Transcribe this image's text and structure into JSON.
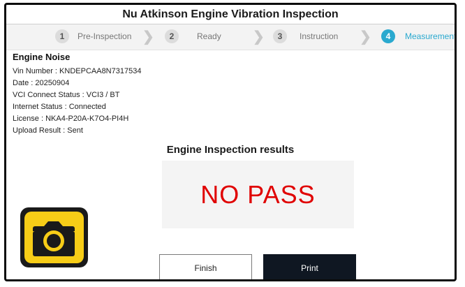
{
  "app": {
    "title": "Nu Atkinson Engine Vibration Inspection"
  },
  "steps": [
    {
      "number": "1",
      "label": "Pre-Inspection",
      "active": false
    },
    {
      "number": "2",
      "label": "Ready",
      "active": false
    },
    {
      "number": "3",
      "label": "Instruction",
      "active": false
    },
    {
      "number": "4",
      "label": "Measurement",
      "active": true
    }
  ],
  "step_separator_icon": "chevron-right-icon",
  "info": {
    "heading": "Engine Noise",
    "lines": [
      "Vin Number : KNDEPCAA8N7317534",
      "Date : 20250904",
      "VCI Connect Status : VCI3 / BT",
      "Internet Status : Connected",
      "License : NKA4-P20A-K7O4-PI4H",
      "Upload Result : Sent"
    ]
  },
  "results": {
    "title": "Engine Inspection results",
    "value": "NO PASS"
  },
  "camera": {
    "icon": "camera-icon"
  },
  "actions": {
    "finish_label": "Finish",
    "print_label": "Print"
  },
  "colors": {
    "accent": "#2aa9cf",
    "fail_text": "#e00000",
    "camera_yellow": "#f7cd17",
    "print_button": "#0f1722"
  }
}
